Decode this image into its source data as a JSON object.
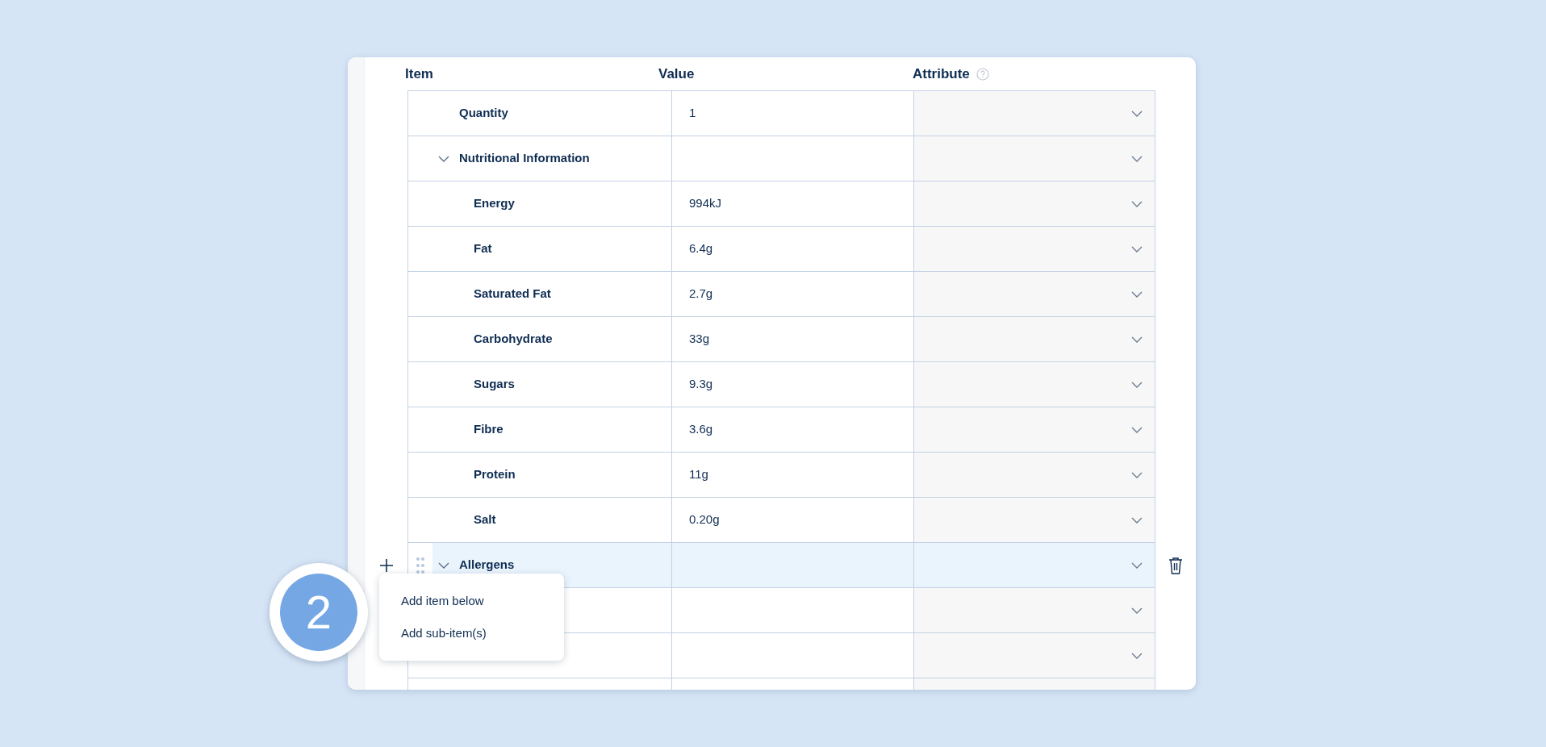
{
  "table": {
    "columns": [
      {
        "label": "Item",
        "help": false
      },
      {
        "label": "Value",
        "help": false
      },
      {
        "label": "Attribute",
        "help": true
      }
    ],
    "rows": [
      {
        "item": "Quantity",
        "value": "1",
        "selected": false
      },
      {
        "item": "Nutritional Information",
        "selected": false,
        "expanded": true,
        "children": [
          {
            "item": "Energy",
            "value": "994kJ",
            "selected": false
          },
          {
            "item": "Fat",
            "value": "6.4g",
            "selected": false
          },
          {
            "item": "Saturated Fat",
            "value": "2.7g",
            "selected": false
          },
          {
            "item": "Carbohydrate",
            "value": "33g",
            "selected": false
          },
          {
            "item": "Sugars",
            "value": "9.3g",
            "selected": false
          },
          {
            "item": "Fibre",
            "value": "3.6g",
            "selected": false
          },
          {
            "item": "Protein",
            "value": "11g",
            "selected": false
          },
          {
            "item": "Salt",
            "value": "0.20g",
            "selected": false
          }
        ]
      },
      {
        "item": "Allergens",
        "selected": true,
        "expanded": true,
        "children": [
          {
            "selected": false
          },
          {
            "selected": false
          }
        ]
      },
      {
        "selected": false
      }
    ]
  },
  "context_menu": {
    "items": [
      "Add item below",
      "Add sub-item(s)"
    ]
  },
  "step_badge": {
    "label": "2"
  }
}
